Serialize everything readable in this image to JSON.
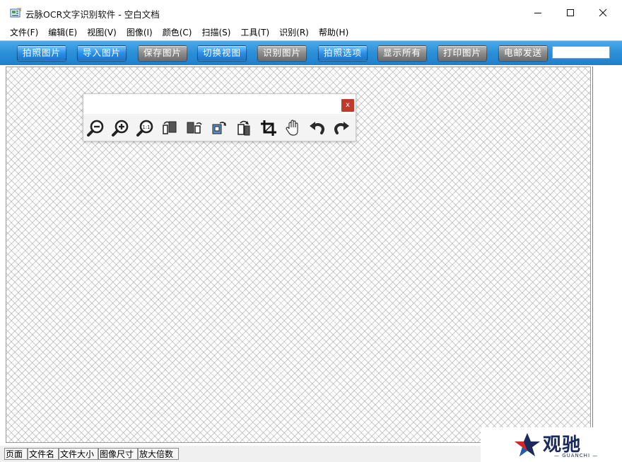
{
  "window": {
    "title": "云脉OCR文字识别软件 - 空白文档"
  },
  "menu": [
    {
      "label": "文件(F)"
    },
    {
      "label": "编辑(E)"
    },
    {
      "label": "视图(V)"
    },
    {
      "label": "图像(I)"
    },
    {
      "label": "颜色(C)"
    },
    {
      "label": "扫描(S)"
    },
    {
      "label": "工具(T)"
    },
    {
      "label": "识别(R)"
    },
    {
      "label": "帮助(H)"
    }
  ],
  "toolbar": {
    "buttons": [
      {
        "label": "拍照图片",
        "style": "blue"
      },
      {
        "label": "导入图片",
        "style": "blue"
      },
      {
        "label": "保存图片",
        "style": "gray"
      },
      {
        "label": "切换视图",
        "style": "blue"
      },
      {
        "label": "识别图片",
        "style": "gray"
      },
      {
        "label": "拍照选项",
        "style": "blue"
      },
      {
        "label": "显示所有",
        "style": "gray"
      },
      {
        "label": "打印图片",
        "style": "gray"
      },
      {
        "label": "电邮发送",
        "style": "gray"
      }
    ],
    "search_value": ""
  },
  "image_tools": {
    "close_label": "x",
    "icons": [
      "zoom-out-icon",
      "zoom-in-icon",
      "actual-size-icon",
      "rotate-left-icon",
      "flip-icon",
      "rotate-right-icon",
      "rotate-180-icon",
      "crop-icon",
      "hand-pan-icon",
      "undo-icon",
      "redo-icon"
    ],
    "zoom_actual_label": "1:1"
  },
  "status": {
    "page": "页面",
    "filename": "文件名",
    "filesize": "文件大小",
    "imagesize": "图像尺寸",
    "zoom": "放大倍数"
  },
  "watermark": {
    "text": "观驰",
    "sub": "— GUANCHI —"
  },
  "colors": {
    "toolbar_blue": "#2b8fd8",
    "button_blue": "#2d8fe6",
    "button_gray": "#8c8c8c",
    "close_red": "#c0392b"
  }
}
